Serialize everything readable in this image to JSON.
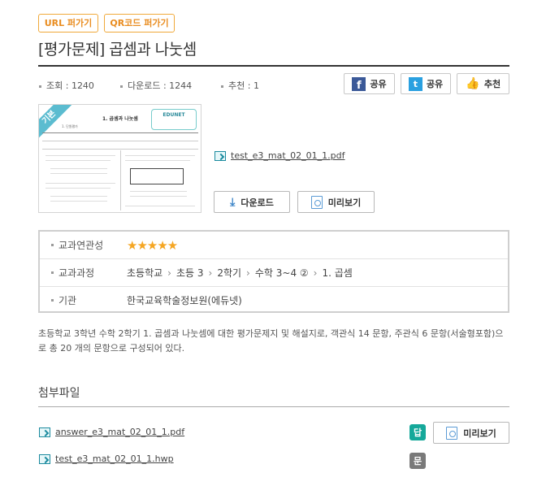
{
  "tags": {
    "url": "URL 퍼가기",
    "qr": "QR코드 퍼가기"
  },
  "title": "[평가문제] 곱셈과 나눗셈",
  "stats": {
    "views": "조회 : 1240",
    "downloads": "다운로드 : 1244",
    "recommend": "추천 : 1"
  },
  "share": {
    "facebook": "공유",
    "twitter": "공유",
    "recommend": "추천"
  },
  "thumbnail": {
    "ribbon": "기본",
    "doc_title": "1. 곱셈과 나눗셈",
    "brand": "EDUNET",
    "section": "1. 단원평가"
  },
  "main_file": "test_e3_mat_02_01_1.pdf",
  "buttons": {
    "download": "다운로드",
    "preview": "미리보기"
  },
  "info": {
    "relevance_label": "교과연관성",
    "rating": 5,
    "rating_display": "★★★★★",
    "curriculum_label": "교과과정",
    "curriculum_path": [
      "초등학교",
      "초등 3",
      "2학기",
      "수학 3~4 ②",
      "1. 곱셈"
    ],
    "org_label": "기관",
    "org_value": "한국교육학술정보원(에듀넷)"
  },
  "description": "초등학교 3학년 수학 2학기 1. 곱셈과 나눗셈에 대한 평가문제지 및 해설지로, 객관식 14 문항, 주관식 6 문항(서술형포함)으로 총 20 개의 문항으로 구성되어 있다.",
  "attachments": {
    "title": "첨부파일",
    "items": [
      {
        "name": "answer_e3_mat_02_01_1.pdf",
        "badge": "답",
        "preview": "미리보기"
      },
      {
        "name": "test_e3_mat_02_01_1.hwp",
        "badge": "문"
      }
    ]
  },
  "colors": {
    "accent": "#f0a93a",
    "star": "#f5a623",
    "answer_badge": "#15a89a",
    "question_badge": "#7a7a7a"
  }
}
